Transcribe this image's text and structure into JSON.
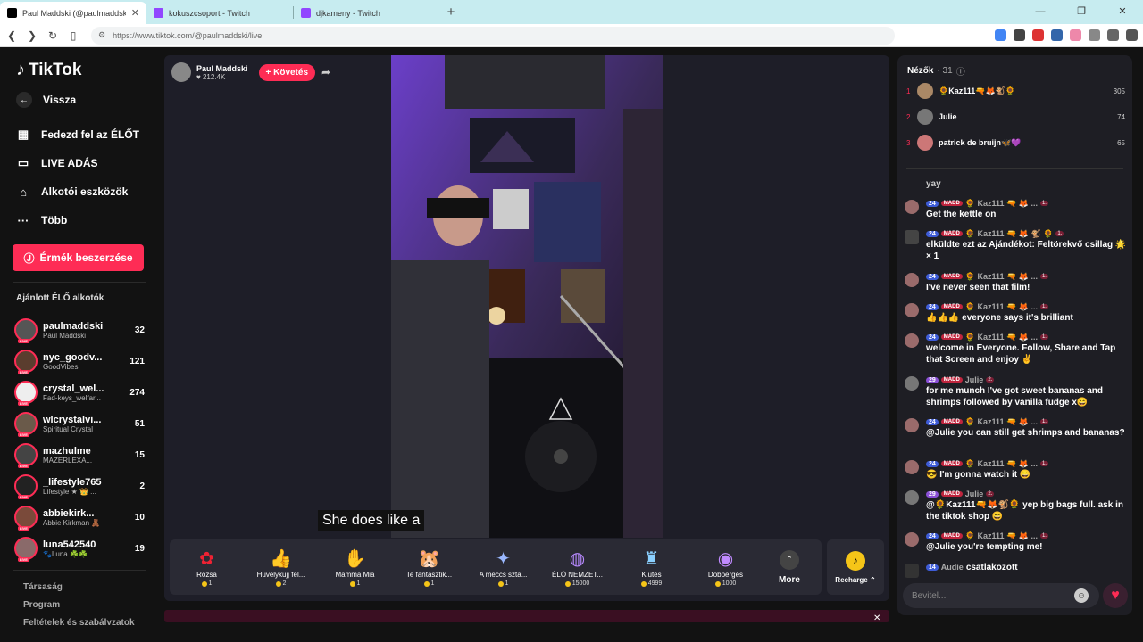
{
  "browser": {
    "tabs": [
      {
        "title": "Paul Maddski (@paulmaddski)",
        "active": true
      },
      {
        "title": "kokuszcsoport - Twitch",
        "active": false
      },
      {
        "title": "djkameny - Twitch",
        "active": false
      }
    ],
    "url": "https://www.tiktok.com/@paulmaddski/live"
  },
  "sidebar": {
    "logo": "TikTok",
    "back": "Vissza",
    "menu": [
      {
        "label": "Fedezd fel az ÉLŐT",
        "icon": "calendar-icon"
      },
      {
        "label": "LIVE ADÁS",
        "icon": "video-camera-icon"
      },
      {
        "label": "Alkotói eszközök",
        "icon": "home-tools-icon"
      },
      {
        "label": "Több",
        "icon": "more-dots-icon"
      }
    ],
    "coins_button": "Érmék beszerzése",
    "recommended_title": "Ajánlott ÉLŐ alkotók",
    "creators": [
      {
        "name": "paulmaddski",
        "sub": "Paul Maddski",
        "count": "32"
      },
      {
        "name": "nyc_goodv...",
        "sub": "GoodVibes",
        "count": "121"
      },
      {
        "name": "crystal_wel...",
        "sub": "Fad-keys_welfar...",
        "count": "274"
      },
      {
        "name": "wlcrystalvi...",
        "sub": "Spiritual Crystal",
        "count": "51"
      },
      {
        "name": "mazhulme",
        "sub": "MAZERLEXA...",
        "count": "15"
      },
      {
        "name": "_lifestyle765",
        "sub": "Lifestyle ★ 👑 ...",
        "count": "2"
      },
      {
        "name": "abbiekirk...",
        "sub": "Abbie Kirkman 🧸",
        "count": "10"
      },
      {
        "name": "luna542540",
        "sub": "🐾Luna ☘️☘️",
        "count": "19"
      }
    ],
    "footer": [
      "Társaság",
      "Program",
      "Feltételek és szabályzatok"
    ]
  },
  "stream": {
    "host_name": "Paul Maddski",
    "host_likes": "212.4K",
    "follow_label": "+ Követés",
    "subtitle": "She does like a",
    "gifts": [
      {
        "name": "Rózsa",
        "price": "1",
        "icon": "rose-icon"
      },
      {
        "name": "Hüvelykujj fel...",
        "price": "2",
        "icon": "thumbs-up-icon"
      },
      {
        "name": "Mamma Mia",
        "price": "1",
        "icon": "hand-kiss-icon"
      },
      {
        "name": "Te fantasztik...",
        "price": "1",
        "icon": "hamster-icon"
      },
      {
        "name": "A meccs szta...",
        "price": "1",
        "icon": "star-icon"
      },
      {
        "name": "ÉLŐ NEMZET...",
        "price": "15000",
        "icon": "planet-icon"
      },
      {
        "name": "Kiütés",
        "price": "4999",
        "icon": "castle-icon"
      },
      {
        "name": "Dobpergés",
        "price": "1000",
        "icon": "drum-icon"
      }
    ],
    "more_label": "More",
    "recharge_label": "Recharge"
  },
  "chat": {
    "viewers_label": "Nézők",
    "viewers_count": "· 31",
    "top_viewers": [
      {
        "rank": "1",
        "name": "🌻Kaz111🔫🦊🐒🌻",
        "points": "305"
      },
      {
        "rank": "2",
        "name": "Julie",
        "points": "74"
      },
      {
        "rank": "3",
        "name": "patrick de bruijn🦋💜",
        "points": "65"
      }
    ],
    "messages": [
      {
        "level": "",
        "fan": "",
        "user": "",
        "text": "yay"
      },
      {
        "level": "24",
        "fan": "MADD",
        "user": "🌻 Kaz111 🔫 🦊 ...",
        "rank": "1.",
        "text": "Get the kettle on"
      },
      {
        "level": "24",
        "fan": "MADD",
        "user": "🌻 Kaz111 🔫 🦊 🐒 🌻",
        "rank": "1.",
        "text": "elküldte ezt az Ajándékot: Feltörekvő csillag 🌟 × 1"
      },
      {
        "level": "24",
        "fan": "MADD",
        "user": "🌻 Kaz111 🔫 🦊 ...",
        "rank": "1.",
        "text": "I've never seen that film!"
      },
      {
        "level": "24",
        "fan": "MADD",
        "user": "🌻 Kaz111 🔫 🦊 ...",
        "rank": "1.",
        "text": "👍👍👍 everyone says it's brilliant"
      },
      {
        "level": "24",
        "fan": "MADD",
        "user": "🌻 Kaz111 🔫 🦊 ...",
        "rank": "1.",
        "text": "welcome in Everyone. Follow, Share and Tap that Screen and enjoy ✌"
      },
      {
        "level": "29",
        "fan": "MADD",
        "user": "Julie",
        "rank": "2.",
        "text": "for me munch I've got sweet bananas and shrimps followed by vanilla fudge x😄"
      },
      {
        "level": "24",
        "fan": "MADD",
        "user": "🌻 Kaz111 🔫 🦊 ...",
        "rank": "1.",
        "text": "@Julie you can still get shrimps and bananas?"
      },
      {
        "level": "24",
        "fan": "MADD",
        "user": "🌻 Kaz111 🔫 🦊 ...",
        "rank": "1.",
        "text": "😎 I'm gonna watch it 😄"
      },
      {
        "level": "29",
        "fan": "MADD",
        "user": "Julie",
        "rank": "2.",
        "text": "@🌻Kaz111🔫🦊🐒🌻 yep big bags full. ask in the tiktok shop 😄"
      },
      {
        "level": "24",
        "fan": "MADD",
        "user": "🌻 Kaz111 🔫 🦊 ...",
        "rank": "1.",
        "text": "@Julie you're tempting me!"
      },
      {
        "level": "14",
        "fan": "",
        "user": "Audie",
        "rank": "",
        "text": "csatlakozott"
      }
    ],
    "input_placeholder": "Bevitel..."
  }
}
